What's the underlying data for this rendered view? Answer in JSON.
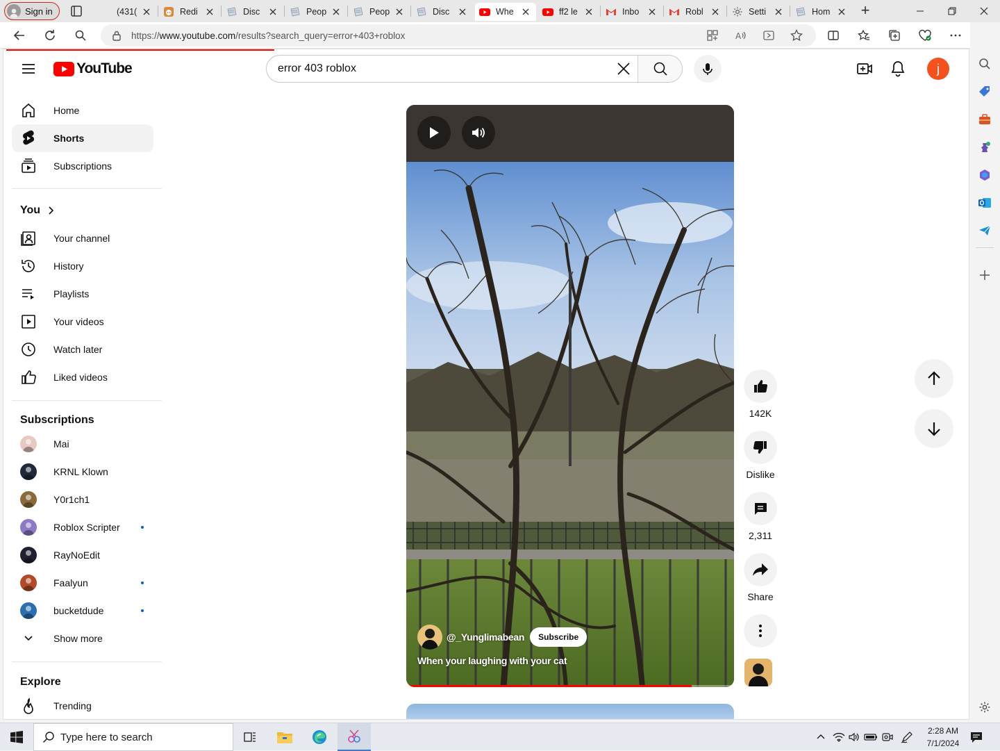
{
  "browser": {
    "profile_label": "Sign in",
    "tabs": [
      {
        "title": "(431(",
        "icon": "blank"
      },
      {
        "title": "Redi",
        "icon": "reddit"
      },
      {
        "title": "Disc",
        "icon": "page"
      },
      {
        "title": "Peop",
        "icon": "page"
      },
      {
        "title": "Peop",
        "icon": "page"
      },
      {
        "title": "Disc",
        "icon": "page"
      },
      {
        "title": "Whe",
        "icon": "youtube",
        "active": true
      },
      {
        "title": "ff2 le",
        "icon": "youtube"
      },
      {
        "title": "Inbo",
        "icon": "gmail"
      },
      {
        "title": "Robl",
        "icon": "gmail"
      },
      {
        "title": "Setti",
        "icon": "gear"
      },
      {
        "title": "Hom",
        "icon": "page"
      }
    ],
    "url_prefix": "https://",
    "url_host": "www.youtube.com",
    "url_path": "/results?search_query=error+403+roblox"
  },
  "youtube": {
    "logo_text": "YouTube",
    "search_value": "error 403 roblox",
    "account_initial": "j",
    "accent_red": "#ff0000",
    "avatar_color": "#f4511e"
  },
  "sidebar": {
    "main": [
      {
        "label": "Home",
        "icon": "home-icon"
      },
      {
        "label": "Shorts",
        "icon": "shorts-icon",
        "selected": true
      },
      {
        "label": "Subscriptions",
        "icon": "subscriptions-icon"
      }
    ],
    "you_heading": "You",
    "you_items": [
      {
        "label": "Your channel",
        "icon": "your-channel-icon"
      },
      {
        "label": "History",
        "icon": "history-icon"
      },
      {
        "label": "Playlists",
        "icon": "playlists-icon"
      },
      {
        "label": "Your videos",
        "icon": "your-videos-icon"
      },
      {
        "label": "Watch later",
        "icon": "watch-later-icon"
      },
      {
        "label": "Liked videos",
        "icon": "liked-videos-icon"
      }
    ],
    "subs_heading": "Subscriptions",
    "subscriptions": [
      {
        "label": "Mai",
        "color": "#e8c9c2",
        "dot": false
      },
      {
        "label": "KRNL Klown",
        "color": "#1e2a3a",
        "dot": false
      },
      {
        "label": "Y0r1ch1",
        "color": "#8a6a3a",
        "dot": false
      },
      {
        "label": "Roblox Scripter",
        "color": "#8d7ac4",
        "dot": true
      },
      {
        "label": "RayNoEdit",
        "color": "#202030",
        "dot": false
      },
      {
        "label": "Faalyun",
        "color": "#b04a2a",
        "dot": true
      },
      {
        "label": "bucketdude",
        "color": "#2c6fb0",
        "dot": true
      }
    ],
    "show_more": "Show more",
    "explore_heading": "Explore",
    "explore_items": [
      {
        "label": "Trending",
        "icon": "trending-icon"
      }
    ]
  },
  "short": {
    "channel_handle": "@_Yunglimabean",
    "subscribe_label": "Subscribe",
    "title": "When your laughing with your cat",
    "progress": 0.87,
    "likes": "142K",
    "dislike_label": "Dislike",
    "comments": "2,311",
    "share_label": "Share"
  },
  "taskbar": {
    "search_placeholder": "Type here to search",
    "time": "2:28 AM",
    "date": "7/1/2024"
  }
}
